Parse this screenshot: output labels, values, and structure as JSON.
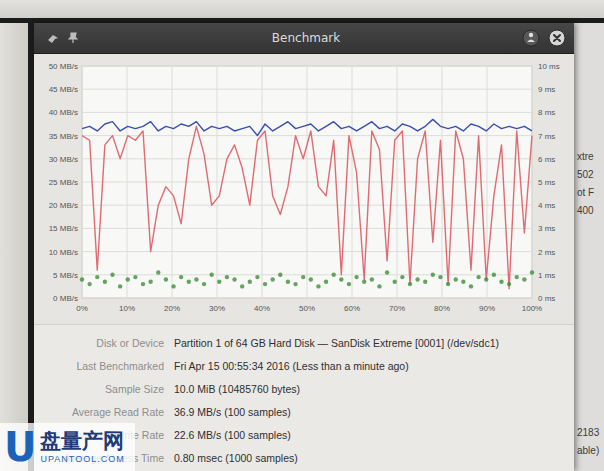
{
  "window": {
    "title": "Benchmark"
  },
  "chart": {
    "y_ticks_left": [
      "50 MB/s",
      "45 MB/s",
      "40 MB/s",
      "35 MB/s",
      "30 MB/s",
      "25 MB/s",
      "20 MB/s",
      "15 MB/s",
      "10 MB/s",
      "5 MB/s",
      "0 MB/s"
    ],
    "y_ticks_right": [
      "10 ms",
      "9 ms",
      "8 ms",
      "7 ms",
      "6 ms",
      "5 ms",
      "4 ms",
      "3 ms",
      "2 ms",
      "1 ms",
      "0 ms"
    ],
    "x_ticks": [
      "0%",
      "10%",
      "20%",
      "30%",
      "40%",
      "50%",
      "60%",
      "70%",
      "80%",
      "90%",
      "100%"
    ],
    "series": [
      {
        "axis": "left",
        "kind": "line",
        "color": "#3b4fb0",
        "values": [
          36.5,
          37,
          36,
          37.5,
          38,
          36,
          37,
          36.5,
          37,
          38,
          36,
          37,
          36.5,
          37.5,
          37,
          38,
          36,
          37,
          36.5,
          37,
          36,
          36.5,
          37,
          35,
          37.5,
          36,
          37,
          38,
          36.5,
          37,
          37.5,
          36,
          37,
          38,
          36.5,
          37,
          36,
          37,
          38,
          36.5,
          37,
          36,
          37.5,
          37,
          36,
          37,
          38.5,
          37,
          36.5,
          37,
          36,
          37.5,
          37,
          36,
          37.5,
          36.5,
          37,
          36.5,
          37,
          36
        ]
      },
      {
        "axis": "left",
        "kind": "line",
        "color": "#e06b72",
        "values": [
          35,
          34,
          6,
          33,
          35,
          30,
          35,
          34,
          36,
          10,
          20,
          24,
          22,
          16,
          30,
          37,
          31,
          20,
          22,
          30,
          33,
          28,
          20,
          34,
          36,
          22,
          18,
          24,
          35,
          30,
          36,
          24,
          22,
          34,
          5,
          35,
          27,
          4,
          36,
          32,
          8,
          34,
          36,
          3,
          30,
          36,
          12,
          34,
          3,
          36,
          30,
          6,
          35,
          4,
          22,
          33,
          2,
          36,
          14,
          35
        ]
      },
      {
        "axis": "right",
        "kind": "dots",
        "color": "#3f8f3a",
        "values": [
          0.8,
          0.6,
          0.9,
          0.7,
          1.0,
          0.5,
          0.8,
          0.9,
          0.6,
          0.7,
          1.1,
          0.8,
          0.5,
          0.9,
          0.7,
          0.8,
          0.6,
          1.0,
          0.7,
          0.9,
          0.8,
          0.5,
          0.7,
          0.9,
          0.6,
          0.8,
          1.0,
          0.7,
          0.6,
          0.9,
          0.8,
          0.5,
          0.7,
          1.0,
          0.8,
          0.6,
          0.9,
          0.7,
          0.8,
          0.5,
          1.1,
          0.7,
          0.9,
          0.6,
          0.8,
          0.7,
          1.0,
          0.9,
          0.6,
          0.8,
          0.7,
          0.5,
          0.9,
          0.8,
          1.0,
          0.7,
          0.6,
          0.9,
          0.8,
          1.1
        ]
      }
    ]
  },
  "details": [
    {
      "label": "Disk or Device",
      "value": "Partition 1 of 64 GB Hard Disk — SanDisk Extreme [0001] (/dev/sdc1)"
    },
    {
      "label": "Last Benchmarked",
      "value": "Fri Apr 15 00:55:34 2016 (Less than a minute ago)"
    },
    {
      "label": "Sample Size",
      "value": "10.0 MiB (10485760 bytes)"
    },
    {
      "label": "Average Read Rate",
      "value": "36.9 MB/s (100 samples)"
    },
    {
      "label": "Average Write Rate",
      "value": "22.6 MB/s (100 samples)"
    },
    {
      "label": "Average Access Time",
      "value": "0.80 msec (1000 samples)"
    }
  ],
  "background_window": {
    "texts_top": [
      "xtre",
      "502",
      "ot F",
      "400"
    ],
    "texts_bottom": [
      "2183",
      "able)"
    ]
  },
  "watermark": {
    "logo": "U",
    "name": "盘量产网",
    "url": "UPANTOOL.COM"
  }
}
